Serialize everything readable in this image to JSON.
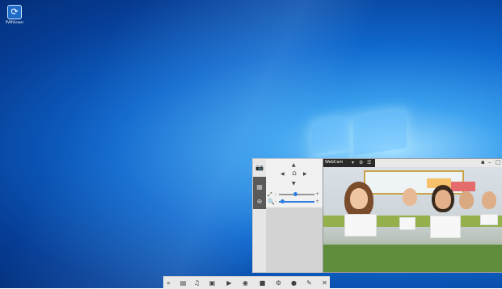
{
  "desktop": {
    "icon_label": "PVMViewer",
    "accent": "#0f67cc"
  },
  "control_panel": {
    "side_buttons": [
      "camera-icon",
      "grid-icon",
      "zoom-icon"
    ],
    "ptz": {
      "home": "home-icon"
    },
    "zoom_slider_level": 0.45,
    "focus_slider_level": 0.08
  },
  "video": {
    "camera_name": "WebCam",
    "toolbar_icons": [
      "dropdown-icon",
      "settings-icon",
      "bars-icon"
    ],
    "window_icons": [
      "pin-icon",
      "minimize-icon",
      "maximize-icon"
    ]
  },
  "toolbar": {
    "buttons": [
      "collapse",
      "layout",
      "talk",
      "snapshot",
      "record",
      "broadcast",
      "folder",
      "settings",
      "user",
      "edit",
      "close"
    ]
  }
}
